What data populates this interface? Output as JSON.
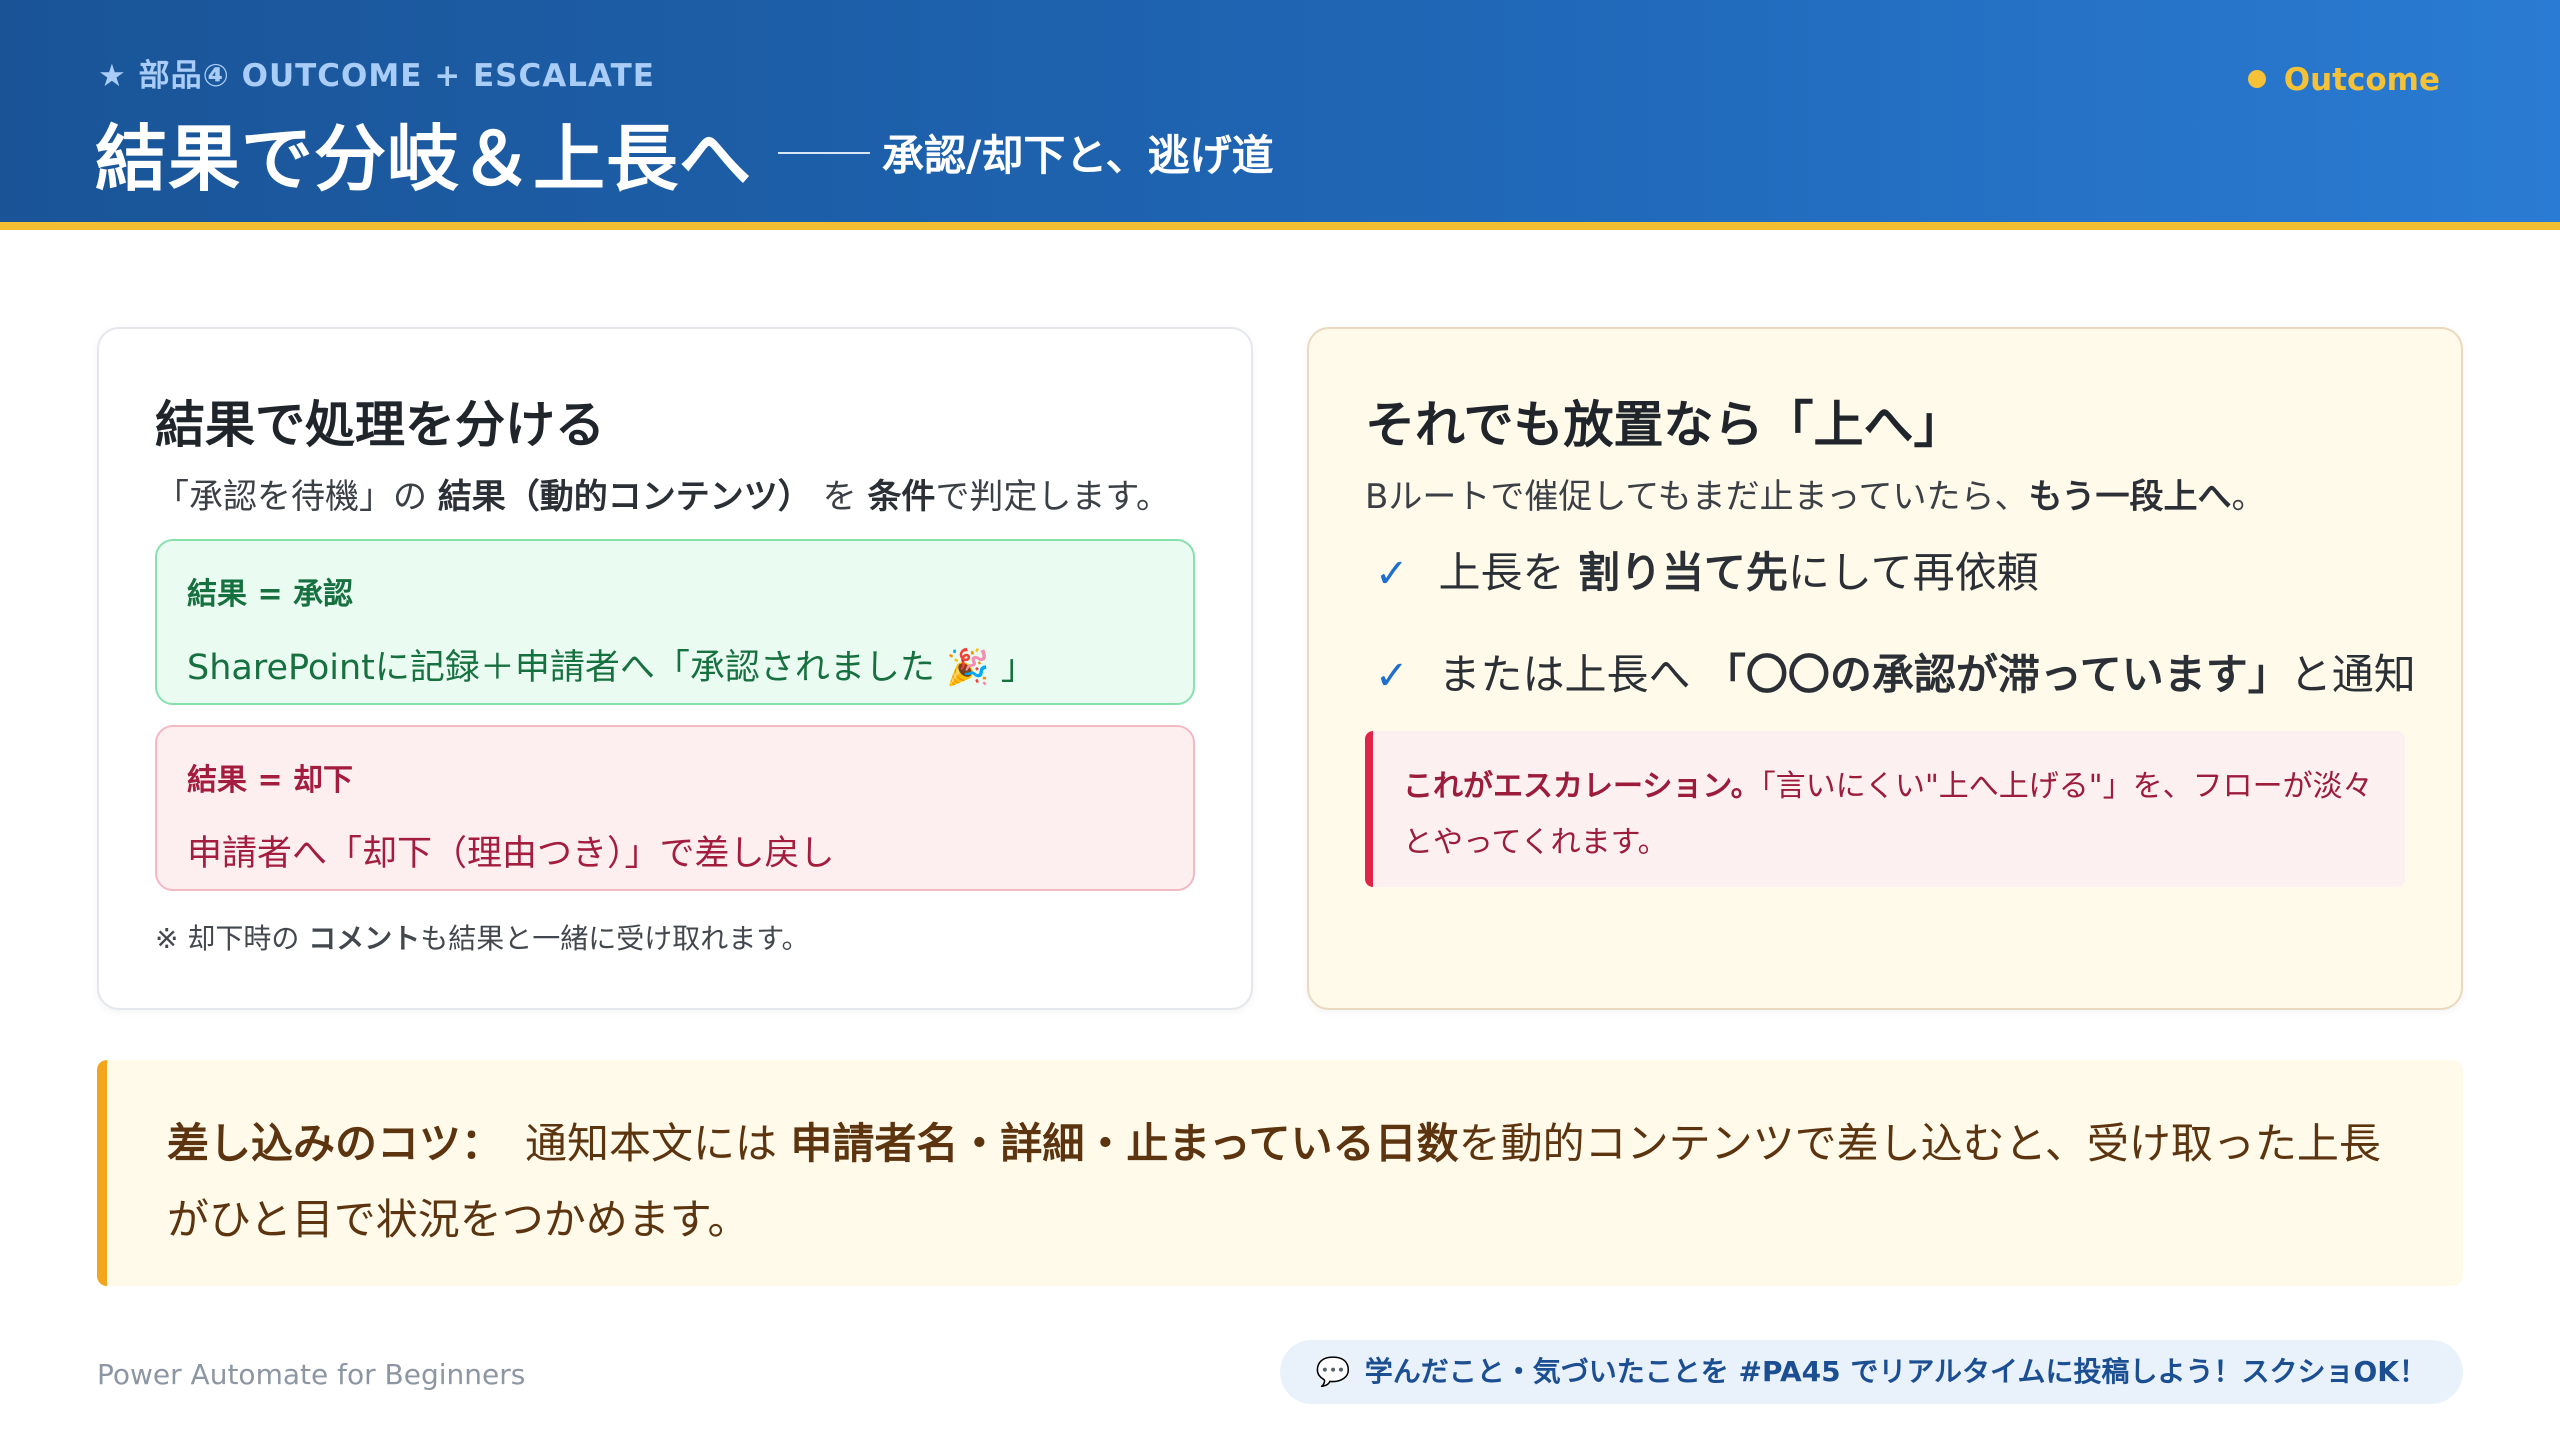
{
  "header": {
    "eyebrow_icon": "★",
    "eyebrow": "部品④ OUTCOME + ESCALATE",
    "title": "結果で分岐＆上長へ",
    "subtitle": "承認/却下と、逃げ道",
    "tag": "Outcome",
    "colors": {
      "primary": "#1f66b5",
      "accent": "#f2be32"
    }
  },
  "left_card": {
    "title": "結果で処理を分ける",
    "lead": {
      "p1": "「承認を待機」の ",
      "b1": "結果（動的コンテンツ）",
      "p2": " を ",
      "b2": "条件",
      "p3": "で判定します。"
    },
    "approve": {
      "head": "結果 = 承認",
      "body": "SharePointに記録＋申請者へ「承認されました 🎉 」"
    },
    "reject": {
      "head": "結果 = 却下",
      "body": "申請者へ「却下（理由つき）」で差し戻し"
    },
    "note": {
      "p1": "※ 却下時の ",
      "b1": "コメント",
      "p2": "も結果と一緒に受け取れます。"
    }
  },
  "right_card": {
    "title": "それでも放置なら「上へ」",
    "lead": {
      "p1": "Bルートで催促してもまだ止まっていたら、",
      "b1": "もう一段上へ",
      "p2": "。"
    },
    "check_icon": "✓",
    "items": [
      {
        "p1": "上長を ",
        "b1": "割り当て先",
        "p2": "にして再依頼"
      },
      {
        "p1": "または上長へ ",
        "b1": "「〇〇の承認が滞っています」",
        "p2": "と通知"
      }
    ],
    "escalation": {
      "b1": "これがエスカレーション。",
      "p1": "「言いにくい\"上へ上げる\"」を、フローが淡々とやってくれます。"
    }
  },
  "tip": {
    "label": "差し込みのコツ：",
    "p1": "通知本文には ",
    "b1": "申請者名・詳細・止まっている日数",
    "p2": "を動的コンテンツで差し込むと、受け取った上長がひと目で状況をつかめます。"
  },
  "footer": {
    "left": "Power Automate for Beginners",
    "bubble_icon": "💬",
    "pill": "学んだこと・気づいたことを #PA45 でリアルタイムに投稿しよう！スクショOK！"
  }
}
